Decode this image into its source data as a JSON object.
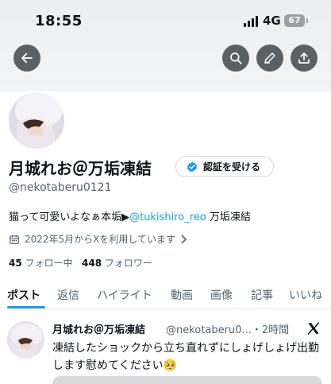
{
  "status_bar": {
    "time": "18:55",
    "network": "4G",
    "battery": "67"
  },
  "nav": {
    "back_icon": "arrow-left-icon",
    "search_icon": "search-icon",
    "edit_icon": "pencil-icon",
    "share_icon": "share-icon"
  },
  "profile": {
    "display_name": "月城れお＠万垢凍結",
    "verify_button": "認証を受ける",
    "handle": "@nekotaberu0121",
    "bio_prefix": "猫って可愛いよなぁ本垢▶",
    "bio_mention": "@tukishiro_reo",
    "bio_suffix": " 万垢凍結",
    "joined": "2022年5月からXを利用しています",
    "following_count": "45",
    "following_label": "フォロー中",
    "followers_count": "448",
    "followers_label": "フォロワー"
  },
  "tabs": [
    "ポスト",
    "返信",
    "ハイライト",
    "動画",
    "画像",
    "記事",
    "いいね"
  ],
  "tweet": {
    "name": "月城れお＠万垢凍結",
    "handle": "@nekotaberu0...",
    "time": "・2時間",
    "text": "凍結したショックから立ち直れずにしょげしょげ出勤します慰めてください🥺"
  },
  "colors": {
    "accent": "#1d9bf0",
    "text": "#0f1419",
    "muted": "#536471"
  }
}
